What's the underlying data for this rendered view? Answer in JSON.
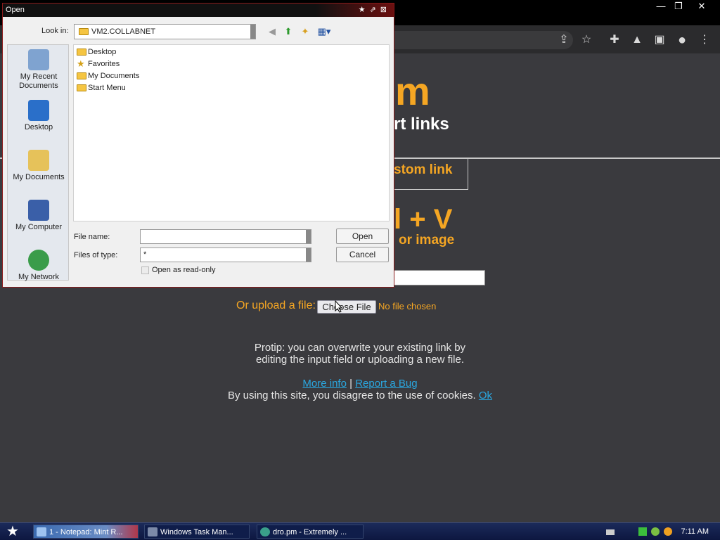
{
  "browser": {
    "window_controls": {
      "minimize": "—",
      "restore": "❐",
      "close": "✕"
    },
    "toolbar_icons": [
      "share-icon",
      "star-icon",
      "extensions-icon",
      "flask-icon",
      "sidepanel-icon",
      "profile-icon",
      "menu-icon"
    ]
  },
  "page": {
    "title": "m",
    "subtitle": "rt links",
    "custom_link": "stom link",
    "paste_title": "l + V",
    "paste_sub": "or image",
    "link_input_value": "",
    "upload_label": "Or upload a file:",
    "choose_file": "Choose File",
    "no_file": "No file chosen",
    "protip_line1": "Protip: you can overwrite your existing link by",
    "protip_line2": "editing the input field or uploading a new file.",
    "more_info": "More info",
    "separator": "|",
    "report_bug": "Report a Bug",
    "cookie_text": "By using this site, you disagree to the use of cookies.",
    "cookie_ok": "Ok",
    "accent_color": "#f5a623",
    "link_color": "#2aa7e0"
  },
  "dialog": {
    "title": "Open",
    "look_in_label": "Look in:",
    "look_in_value": "VM2.COLLABNET",
    "places": [
      {
        "label": "My Recent Documents",
        "icon": "recent-documents-icon"
      },
      {
        "label": "Desktop",
        "icon": "desktop-icon"
      },
      {
        "label": "My Documents",
        "icon": "my-documents-icon"
      },
      {
        "label": "My Computer",
        "icon": "my-computer-icon"
      },
      {
        "label": "My Network",
        "icon": "my-network-icon"
      }
    ],
    "files": [
      {
        "name": "Desktop",
        "icon": "folder-icon"
      },
      {
        "name": "Favorites",
        "icon": "favorites-star-icon"
      },
      {
        "name": "My Documents",
        "icon": "folder-icon"
      },
      {
        "name": "Start Menu",
        "icon": "folder-icon"
      }
    ],
    "file_name_label": "File name:",
    "file_name_value": "",
    "files_of_type_label": "Files of type:",
    "files_of_type_value": "*",
    "open_button": "Open",
    "cancel_button": "Cancel",
    "readonly_label": "Open as read-only"
  },
  "taskbar": {
    "tasks": [
      {
        "label": "1 - Notepad: Mint R..."
      },
      {
        "label": "Windows Task Man..."
      },
      {
        "label": "dro.pm - Extremely ..."
      }
    ],
    "clock": "7:11 AM"
  }
}
